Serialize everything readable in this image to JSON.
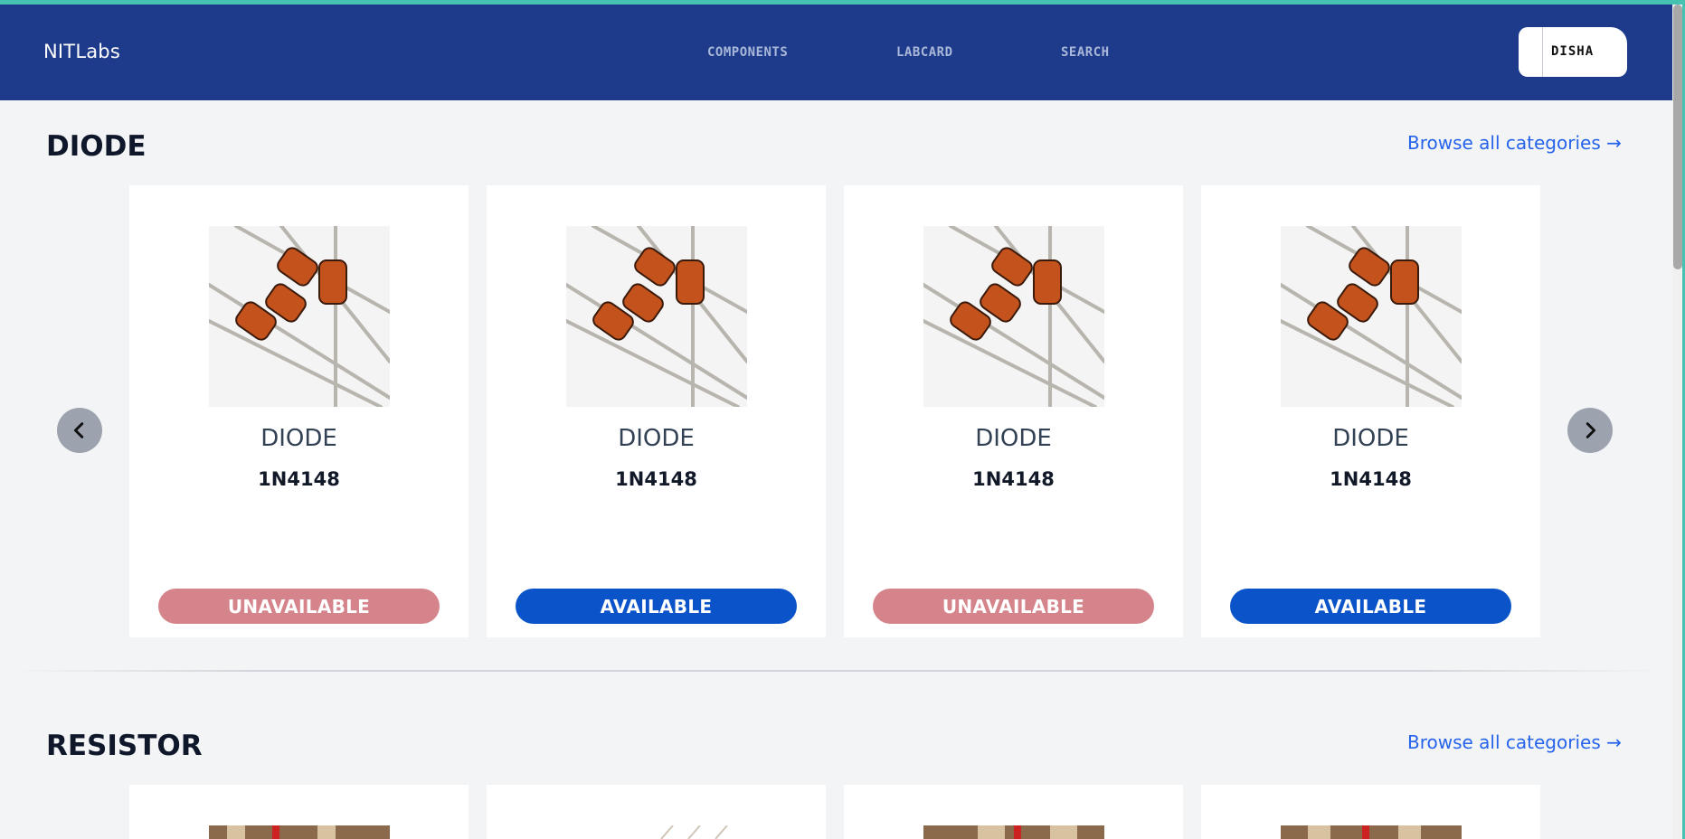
{
  "nav": {
    "brand": "NITLabs",
    "links": [
      "COMPONENTS",
      "LABCARD",
      "SEARCH"
    ],
    "user": "DISHA"
  },
  "sections": [
    {
      "title": "DIODE",
      "browse_label": "Browse all categories →",
      "cards": [
        {
          "category": "DIODE",
          "part": "1N4148",
          "status": "UNAVAILABLE"
        },
        {
          "category": "DIODE",
          "part": "1N4148",
          "status": "AVAILABLE"
        },
        {
          "category": "DIODE",
          "part": "1N4148",
          "status": "UNAVAILABLE"
        },
        {
          "category": "DIODE",
          "part": "1N4148",
          "status": "AVAILABLE"
        }
      ]
    },
    {
      "title": "RESISTOR",
      "browse_label": "Browse all categories →"
    }
  ],
  "colors": {
    "navbar": "#1e3a8a",
    "available": "#0a53c8",
    "unavailable": "#d4848a",
    "link": "#2563eb"
  },
  "icons": {
    "prev": "chevron-left-icon",
    "next": "chevron-right-icon"
  }
}
